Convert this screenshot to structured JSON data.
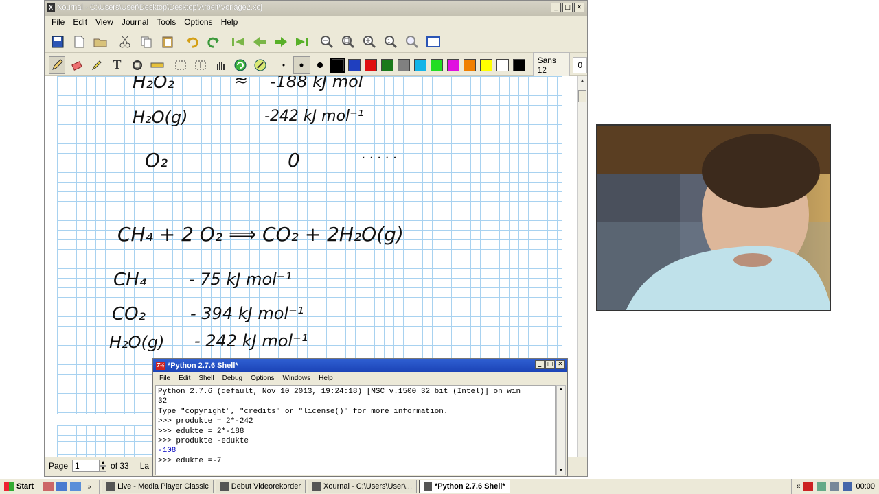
{
  "xournal": {
    "title": "Xournal - C:\\Users\\User\\Desktop\\Desktop\\Arbeit\\Vorlage2.xoj",
    "menu": [
      "File",
      "Edit",
      "View",
      "Journal",
      "Tools",
      "Options",
      "Help"
    ],
    "font_label": "Sans 12",
    "font_size_value": "0",
    "colors": [
      "#000000",
      "#1f3fbf",
      "#e01010",
      "#1a7a1a",
      "#808080",
      "#13b4e8",
      "#22dd22",
      "#e010e0",
      "#f07f00",
      "#ffff00",
      "#ffffff",
      "#000000"
    ],
    "status": {
      "page_label": "Page",
      "page_value": "1",
      "of_label": "of 33",
      "layer_label": "La"
    }
  },
  "notes": {
    "row1_formula": "H₂O₂",
    "row1_approx": "≈",
    "row1_value": "-188 kJ mol",
    "row2_formula": "H₂O(g)",
    "row2_value": "-242 kJ mol⁻¹",
    "row3_formula": "O₂",
    "row3_value": "0",
    "row3_dots": ". . . . .",
    "equation": "CH₄  +  2 O₂  ⟹  CO₂  +  2H₂O(g)",
    "ch4_formula": "CH₄",
    "ch4_value": "- 75  kJ mol⁻¹",
    "co2_formula": "CO₂",
    "co2_value": "- 394  kJ mol⁻¹",
    "h2o_formula": "H₂O(g)",
    "h2o_value": "- 242  kJ mol⁻¹"
  },
  "python": {
    "title": "*Python 2.7.6 Shell*",
    "menu": [
      "File",
      "Edit",
      "Shell",
      "Debug",
      "Options",
      "Windows",
      "Help"
    ],
    "lines": [
      {
        "text": "Python 2.7.6 (default, Nov 10 2013, 19:24:18) [MSC v.1500 32 bit (Intel)] on win",
        "type": "in"
      },
      {
        "text": "32",
        "type": "in"
      },
      {
        "text": "Type \"copyright\", \"credits\" or \"license()\" for more information.",
        "type": "in"
      },
      {
        "text": ">>> produkte = 2*-242",
        "type": "in"
      },
      {
        "text": ">>> edukte = 2*-188",
        "type": "in"
      },
      {
        "text": ">>> produkte -edukte",
        "type": "in"
      },
      {
        "text": "-108",
        "type": "out"
      },
      {
        "text": ">>> edukte =-7",
        "type": "in"
      }
    ]
  },
  "taskbar": {
    "start_label": "Start",
    "tasks": [
      {
        "label": "Live - Media Player Classic",
        "active": false
      },
      {
        "label": "Debut Videorekorder",
        "active": false
      },
      {
        "label": "Xournal - C:\\Users\\User\\...",
        "active": false
      },
      {
        "label": "*Python 2.7.6 Shell*",
        "active": true
      }
    ],
    "clock": "00:00"
  },
  "icons": {
    "xournal": "X",
    "python": "7½",
    "close": "✕",
    "maximize": "□",
    "minimize": "_",
    "more_quicklaunch": "»",
    "more_tray": "«",
    "spin_up": "▲",
    "spin_down": "▼",
    "scroll_up": "▲",
    "scroll_down": "▼"
  }
}
